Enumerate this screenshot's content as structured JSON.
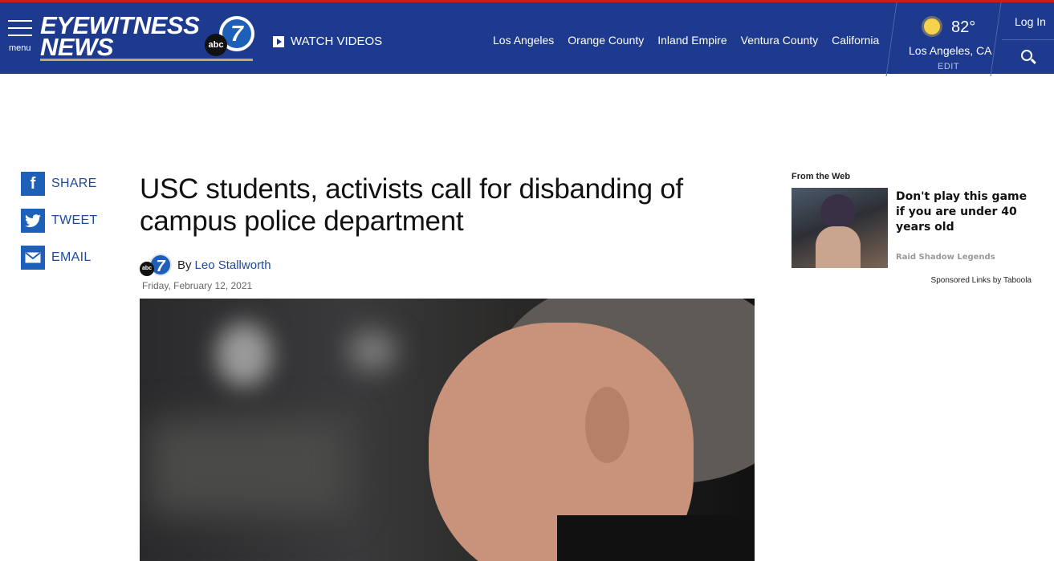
{
  "header": {
    "menu_label": "menu",
    "logo_line1": "EYEWITNESS",
    "logo_line2": "NEWS",
    "logo_abc": "abc",
    "logo_seven": "7",
    "watch_label": "WATCH VIDEOS",
    "nav": [
      "Los Angeles",
      "Orange County",
      "Inland Empire",
      "Ventura County",
      "California"
    ],
    "weather": {
      "temp": "82°",
      "location": "Los Angeles, CA",
      "edit": "EDIT",
      "icon": "sun-icon"
    },
    "login_label": "Log In",
    "colors": {
      "bar": "#1d3a8f",
      "top_stripe": "#d0181f"
    }
  },
  "share": [
    {
      "label": "SHARE",
      "icon": "facebook-icon",
      "glyph": "f"
    },
    {
      "label": "TWEET",
      "icon": "twitter-icon",
      "glyph": "t"
    },
    {
      "label": "EMAIL",
      "icon": "email-icon",
      "glyph": "✉"
    }
  ],
  "article": {
    "headline": "USC students, activists call for disbanding of campus police department",
    "by": "By",
    "author": "Leo Stallworth",
    "date": "Friday, February 12, 2021",
    "byline_logo_abc": "abc",
    "byline_logo_seven": "7"
  },
  "rail": {
    "title": "From the Web",
    "card_text": "Don't play this game if you are under 40 years old",
    "card_sponsor": "Raid Shadow Legends",
    "taboola": "Sponsored Links by Taboola"
  }
}
